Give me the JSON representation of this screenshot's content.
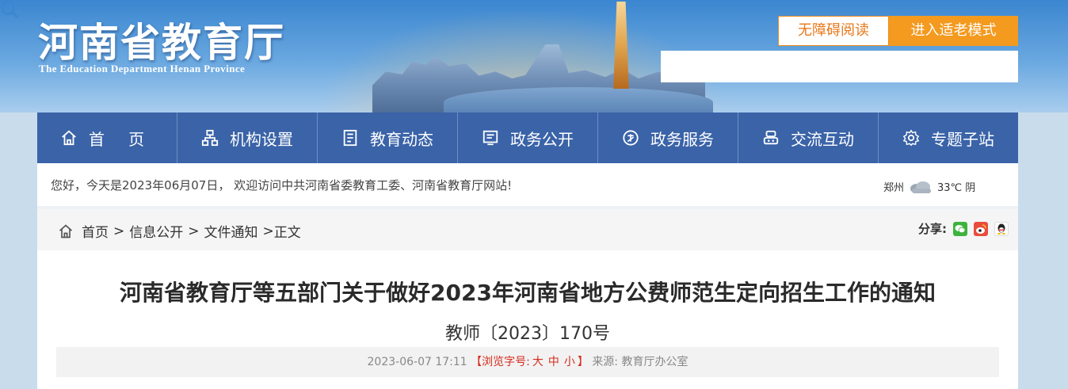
{
  "header": {
    "logo_cn": "河南省教育厅",
    "logo_en": "The Education Department Henan Province",
    "accessible_label": "无障碍阅读",
    "elder_mode_label": "进入适老模式",
    "search_placeholder": ""
  },
  "nav": {
    "items": [
      {
        "label": "首 页",
        "icon": "home-icon"
      },
      {
        "label": "机构设置",
        "icon": "org-chart-icon"
      },
      {
        "label": "教育动态",
        "icon": "document-icon"
      },
      {
        "label": "政务公开",
        "icon": "notice-board-icon"
      },
      {
        "label": "政务服务",
        "icon": "gov-service-icon"
      },
      {
        "label": "交流互动",
        "icon": "interaction-icon"
      },
      {
        "label": "专题子站",
        "icon": "gear-icon"
      }
    ]
  },
  "welcome": {
    "text": "您好，今天是2023年06月07日， 欢迎访问中共河南省委教育工委、河南省教育厅网站!",
    "weather_city": "郑州",
    "weather_temp": "33℃ 阴",
    "weather_icon": "cloudy-icon"
  },
  "breadcrumb": {
    "items": [
      "首页",
      "信息公开",
      "文件通知",
      "正文"
    ],
    "separator": ">"
  },
  "share": {
    "label": "分享:",
    "icons": [
      "wechat-icon",
      "weibo-icon",
      "qq-icon"
    ]
  },
  "article": {
    "title": "河南省教育厅等五部门关于做好2023年河南省地方公费师范生定向招生工作的通知",
    "doc_number": "教师〔2023〕170号",
    "date": "2023-06-07 17:11",
    "font_size_label": "【浏览字号:",
    "font_sizes": [
      "大",
      "中",
      "小"
    ],
    "font_size_close": "】",
    "source_label": "来源:",
    "source": "教育厅办公室"
  },
  "colors": {
    "nav_bg": "#3a63a8",
    "accent_orange": "#f39a1f",
    "link_red": "#d62c1f"
  }
}
